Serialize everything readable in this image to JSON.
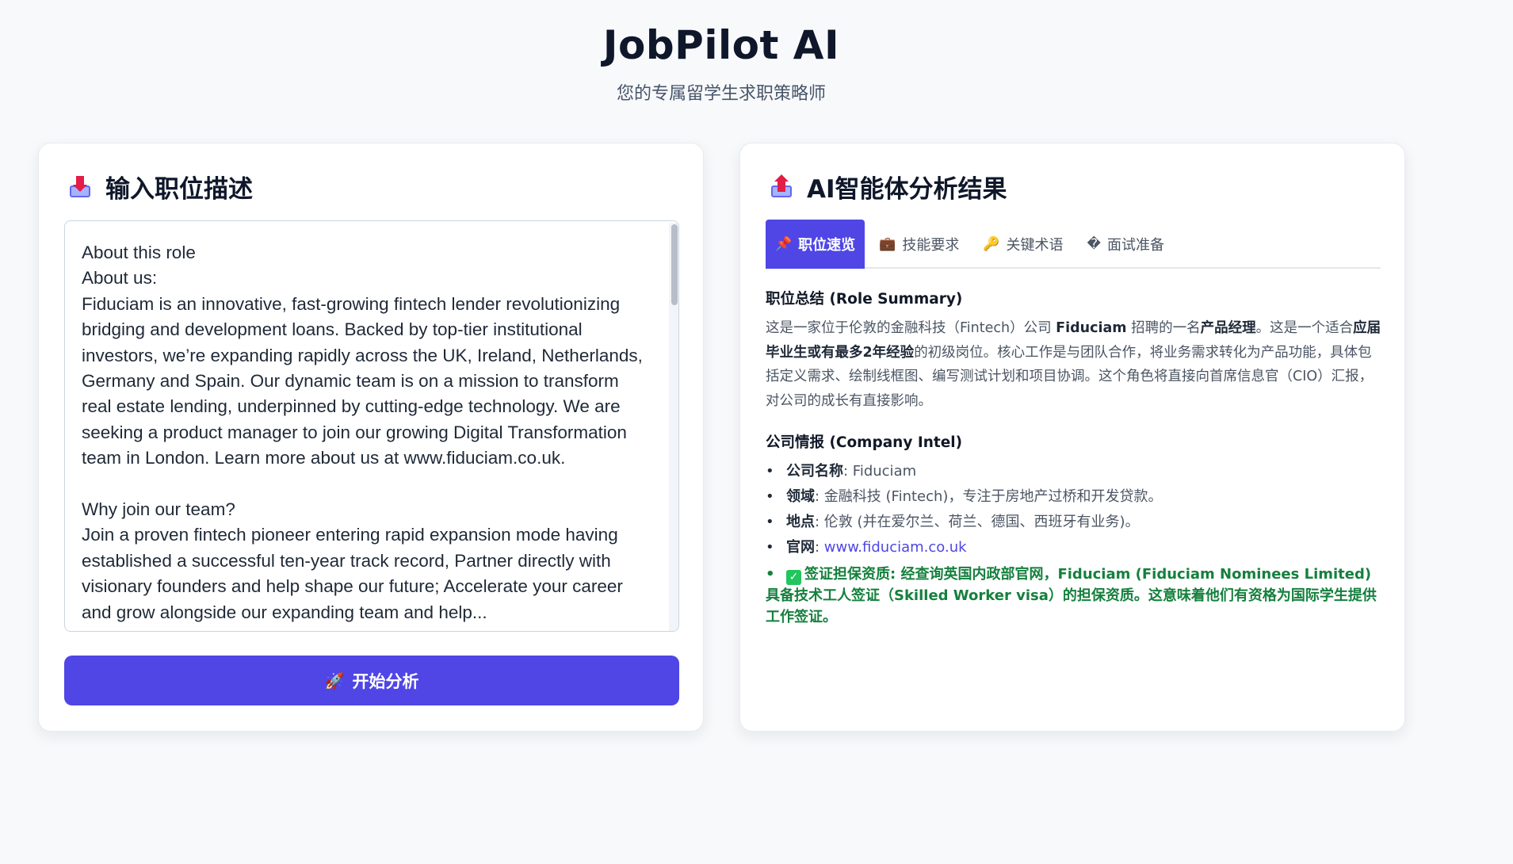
{
  "header": {
    "title": "JobPilot AI",
    "subtitle": "您的专属留学生求职策略师"
  },
  "input_card": {
    "title": "输入职位描述",
    "icon": "inbox-tray-icon",
    "job_description": "About this role\nAbout us:\nFiduciam is an innovative, fast-growing fintech lender revolutionizing bridging and development loans. Backed by top-tier institutional investors, we’re expanding rapidly across the UK, Ireland, Netherlands, Germany and Spain. Our dynamic team is on a mission to transform real estate lending, underpinned by cutting-edge technology. We are seeking a product manager to join our growing Digital Transformation team in London. Learn more about us at www.fiduciam.co.uk.\n\nWhy join our team?\nJoin a proven fintech pioneer entering rapid expansion mode having established a successful ten-year track record, Partner directly with visionary founders and help shape our future; Accelerate your career and grow alongside our expanding team and help...",
    "analyze_button": "开始分析",
    "analyze_icon": "rocket-icon"
  },
  "result_card": {
    "title": "AI智能体分析结果",
    "icon": "outbox-tray-icon",
    "tabs": [
      {
        "label": "职位速览",
        "icon": "📌",
        "active": true
      },
      {
        "label": "技能要求",
        "icon": "💼",
        "active": false
      },
      {
        "label": "关键术语",
        "icon": "🔑",
        "active": false
      },
      {
        "label": "面试准备",
        "icon": "�",
        "active": false
      }
    ],
    "role_summary_title": "职位总结 (Role Summary)",
    "summary": {
      "p1": "这是一家位于伦敦的金融科技（Fintech）公司 ",
      "company": "Fiduciam",
      "p2": " 招聘的一名",
      "role": "产品经理",
      "p3": "。这是一个适合",
      "level": "应届毕业生或有最多2年经验",
      "p4": "的初级岗位。核心工作是与团队合作，将业务需求转化为产品功能，具体包括定义需求、绘制线框图、编写测试计划和项目协调。这个角色将直接向首席信息官（CIO）汇报，对公司的成长有直接影响。"
    },
    "company_intel_title": "公司情报 (Company Intel)",
    "intel": {
      "name_label": "公司名称",
      "name_value": ": Fiduciam",
      "field_label": "领域",
      "field_value": ": 金融科技 (Fintech)，专注于房地产过桥和开发贷款。",
      "location_label": "地点",
      "location_value": ": 伦敦 (并在爱尔兰、荷兰、德国、西班牙有业务)。",
      "website_label": "官网",
      "website_sep": ": ",
      "website_value": "www.fiduciam.co.uk",
      "visa_text": "签证担保资质: 经查询英国内政部官网，Fiduciam (Fiduciam Nominees Limited) 具备技术工人签证（Skilled Worker visa）的担保资质。这意味着他们有资格为国际学生提供工作签证。"
    }
  },
  "colors": {
    "accent": "#4f46e5",
    "success": "#15803d",
    "background": "#f8f9fb"
  }
}
